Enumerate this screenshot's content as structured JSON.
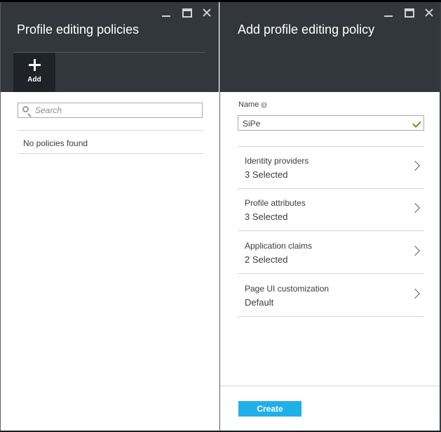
{
  "left_blade": {
    "title": "Profile editing policies",
    "commands": {
      "add_label": "Add",
      "add_icon": "plus-icon"
    },
    "search": {
      "placeholder": "Search",
      "value": ""
    },
    "empty_message": "No policies found"
  },
  "right_blade": {
    "title": "Add profile editing policy",
    "name_field": {
      "label": "Name",
      "value": "SiPe",
      "valid": true
    },
    "rows": [
      {
        "label": "Identity providers",
        "value": "3 Selected"
      },
      {
        "label": "Profile attributes",
        "value": "3 Selected"
      },
      {
        "label": "Application claims",
        "value": "2 Selected"
      },
      {
        "label": "Page UI customization",
        "value": "Default"
      }
    ],
    "create_label": "Create"
  },
  "colors": {
    "header_bg": "#32363d",
    "command_bg": "#1f2227",
    "primary_button": "#1fb0e8",
    "valid_check": "#5aa31f"
  }
}
